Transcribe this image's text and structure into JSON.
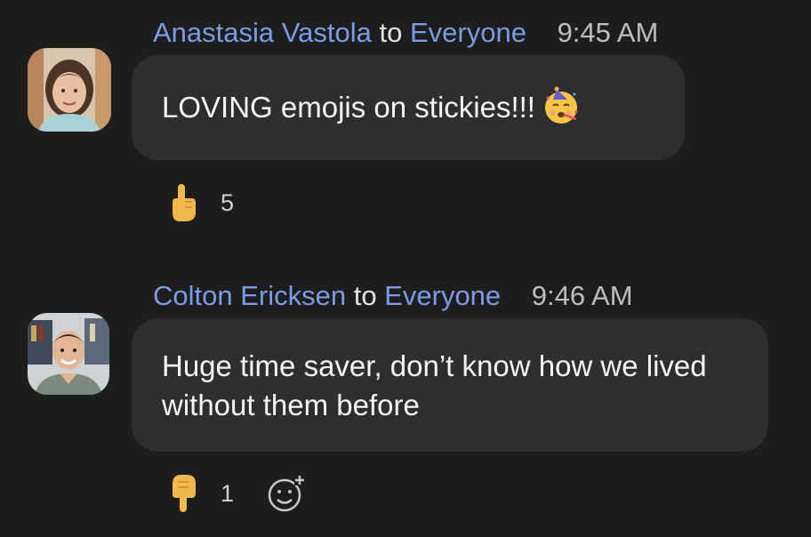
{
  "messages": [
    {
      "sender": "Anastasia Vastola",
      "to_word": "to",
      "recipient": "Everyone",
      "time": "9:45 AM",
      "text": "LOVING emojis on stickies!!!",
      "inline_emoji": "partying-face-icon",
      "reaction": {
        "icon": "pointing-up-hand-icon",
        "count": "5"
      }
    },
    {
      "sender": "Colton Ericksen",
      "to_word": "to",
      "recipient": "Everyone",
      "time": "9:46 AM",
      "text": "Huge time saver, don’t know how we lived without them before",
      "reaction": {
        "icon": "pointing-down-hand-icon",
        "count": "1"
      },
      "add_reaction_icon": "add-reaction-icon"
    }
  ],
  "colors": {
    "background": "#1d1d1e",
    "bubble": "#2e2e30",
    "name_accent": "#7b9be3",
    "emoji_yellow": "#f6c544"
  }
}
